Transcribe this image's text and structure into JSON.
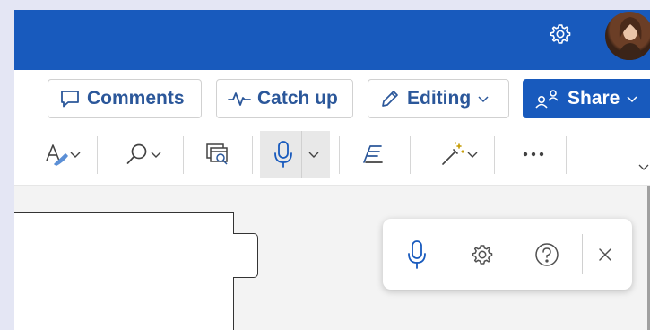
{
  "colors": {
    "brand": "#185abd",
    "accent_text": "#2b579a",
    "canvas": "#f3f3f3"
  },
  "titlebar": {
    "icons": [
      "gear-icon",
      "avatar"
    ]
  },
  "ribbon": {
    "comments_label": "Comments",
    "catchup_label": "Catch up",
    "editing_label": "Editing",
    "share_label": "Share"
  },
  "toolbar": {
    "icons": [
      "styles-icon",
      "find-icon",
      "reuse-files-icon",
      "dictate-icon",
      "editor-icon",
      "designer-icon",
      "more-icon"
    ]
  },
  "dictation_panel": {
    "icons": [
      "microphone-icon",
      "settings-icon",
      "help-icon",
      "close-icon"
    ]
  }
}
